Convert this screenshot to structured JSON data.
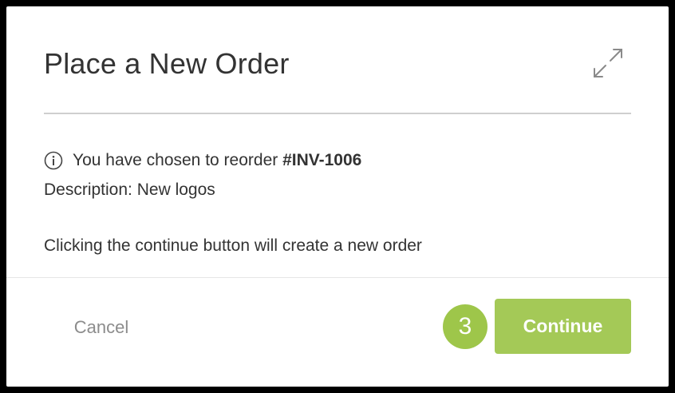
{
  "dialog": {
    "title": "Place a New Order",
    "expand_icon": "expand-arrows-icon"
  },
  "body": {
    "info_icon": "info-circle-icon",
    "info_text": "You have chosen to reorder ",
    "invoice_number": "#INV-1006",
    "description_label": "Description:",
    "description_value": "New logos",
    "note": "Clicking the continue button will create a new order"
  },
  "footer": {
    "cancel_label": "Cancel",
    "step_number": "3",
    "continue_label": "Continue"
  },
  "colors": {
    "accent_green": "#a4c957",
    "badge_green": "#9ec64a",
    "text_dark": "#333333",
    "text_muted": "#8c8c8c"
  }
}
